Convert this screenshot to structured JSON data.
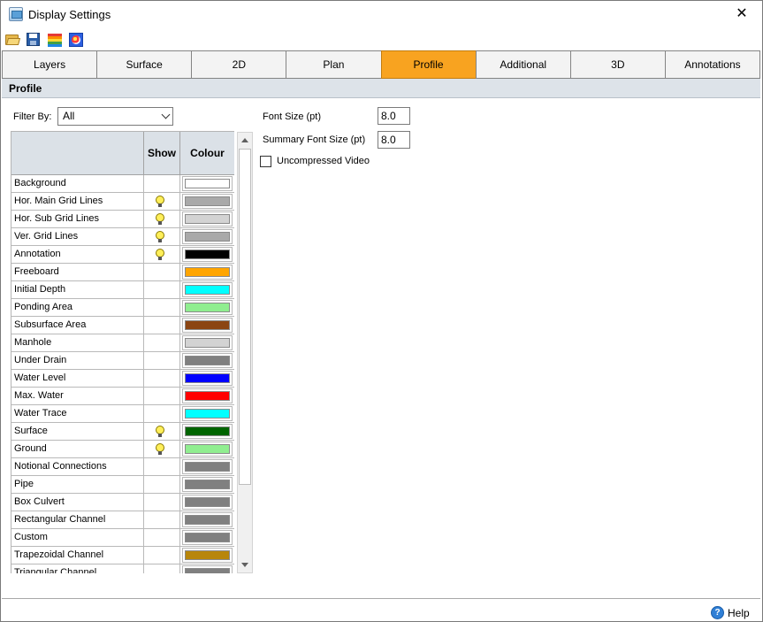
{
  "window": {
    "title": "Display Settings",
    "close_glyph": "✕"
  },
  "toolbar": {
    "icons": [
      "open-folder-icon",
      "save-icon",
      "color-ramp-icon",
      "palette-icon"
    ]
  },
  "tabs": [
    {
      "label": "Layers",
      "active": false
    },
    {
      "label": "Surface",
      "active": false
    },
    {
      "label": "2D",
      "active": false
    },
    {
      "label": "Plan",
      "active": false
    },
    {
      "label": "Profile",
      "active": true
    },
    {
      "label": "Additional",
      "active": false
    },
    {
      "label": "3D",
      "active": false
    },
    {
      "label": "Annotations",
      "active": false
    }
  ],
  "section": {
    "title": "Profile"
  },
  "filter": {
    "label": "Filter By:",
    "value": "All"
  },
  "grid": {
    "columns": {
      "show": "Show",
      "colour": "Colour"
    },
    "rows": [
      {
        "name": "Background",
        "show": false,
        "colour": "#FFFFFF"
      },
      {
        "name": "Hor. Main Grid Lines",
        "show": true,
        "colour": "#A9A9A9"
      },
      {
        "name": "Hor. Sub Grid Lines",
        "show": true,
        "colour": "#D3D3D3"
      },
      {
        "name": "Ver. Grid Lines",
        "show": true,
        "colour": "#A9A9A9"
      },
      {
        "name": "Annotation",
        "show": true,
        "colour": "#000000"
      },
      {
        "name": "Freeboard",
        "show": false,
        "colour": "#FFA500"
      },
      {
        "name": "Initial Depth",
        "show": false,
        "colour": "#00FFFF"
      },
      {
        "name": "Ponding Area",
        "show": false,
        "colour": "#90EE90"
      },
      {
        "name": "Subsurface Area",
        "show": false,
        "colour": "#8B4513"
      },
      {
        "name": "Manhole",
        "show": false,
        "colour": "#D3D3D3"
      },
      {
        "name": "Under Drain",
        "show": false,
        "colour": "#808080"
      },
      {
        "name": "Water Level",
        "show": false,
        "colour": "#0000FF"
      },
      {
        "name": "Max. Water",
        "show": false,
        "colour": "#FF0000"
      },
      {
        "name": "Water Trace",
        "show": false,
        "colour": "#00FFFF"
      },
      {
        "name": "Surface",
        "show": true,
        "colour": "#006400"
      },
      {
        "name": "Ground",
        "show": true,
        "colour": "#90EE90"
      },
      {
        "name": "Notional Connections",
        "show": false,
        "colour": "#808080"
      },
      {
        "name": "Pipe",
        "show": false,
        "colour": "#808080"
      },
      {
        "name": "Box Culvert",
        "show": false,
        "colour": "#808080"
      },
      {
        "name": "Rectangular Channel",
        "show": false,
        "colour": "#808080"
      },
      {
        "name": "Custom",
        "show": false,
        "colour": "#808080"
      },
      {
        "name": "Trapezoidal Channel",
        "show": false,
        "colour": "#B8860B"
      },
      {
        "name": "Triangular Channel",
        "show": false,
        "colour": "#808080"
      }
    ]
  },
  "settings": {
    "font_size_label": "Font Size (pt)",
    "font_size_value": "8.0",
    "summary_font_size_label": "Summary Font Size (pt)",
    "summary_font_size_value": "8.0",
    "uncompressed_video_label": "Uncompressed Video",
    "uncompressed_video_checked": false
  },
  "footer": {
    "help_label": "Help",
    "help_glyph": "?"
  },
  "colors": {
    "active_tab": "#F8A320",
    "section_header": "#DDE3E9"
  }
}
